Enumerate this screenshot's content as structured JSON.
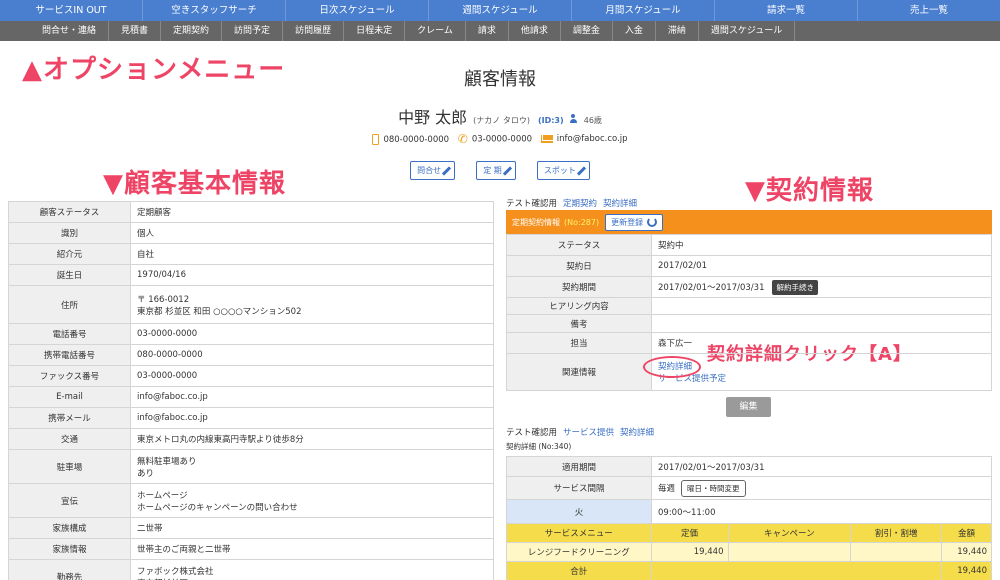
{
  "nav_primary": [
    "サービスIN OUT",
    "空きスタッフサーチ",
    "日次スケジュール",
    "週間スケジュール",
    "月間スケジュール",
    "請求一覧",
    "売上一覧"
  ],
  "nav_secondary": [
    "問合せ・連絡",
    "見積書",
    "定期契約",
    "訪問予定",
    "訪問履歴",
    "日程未定",
    "クレーム",
    "請求",
    "他請求",
    "調整金",
    "入金",
    "滞納",
    "週間スケジュール"
  ],
  "annotations": {
    "option_menu": "▲オプションメニュー",
    "basic_info": "▼顧客基本情報",
    "contract_info": "▼契約情報",
    "click_note": "契約詳細クリック【A】"
  },
  "page_title": "顧客情報",
  "customer": {
    "name": "中野 太郎",
    "kana": "(ナカノ タロウ)",
    "id": "(ID:3)",
    "age": "46歳",
    "mobile": "080-0000-0000",
    "phone": "03-0000-0000",
    "email": "info@faboc.co.jp"
  },
  "action_buttons": [
    "問合せ",
    "定 期",
    "スポット"
  ],
  "basic_table": [
    {
      "k": "顧客ステータス",
      "v": [
        "定期顧客"
      ],
      "h": 21
    },
    {
      "k": "識別",
      "v": [
        "個人"
      ],
      "h": 21
    },
    {
      "k": "紹介元",
      "v": [
        "自社"
      ],
      "h": 21
    },
    {
      "k": "誕生日",
      "v": [
        "1970/04/16"
      ],
      "h": 21
    },
    {
      "k": "住所",
      "v": [
        "〒 166-0012",
        "東京都 杉並区 和田 ○○○○マンション502"
      ],
      "h": 38
    },
    {
      "k": "電話番号",
      "v": [
        "03-0000-0000"
      ],
      "h": 21
    },
    {
      "k": "携帯電話番号",
      "v": [
        "080-0000-0000"
      ],
      "h": 21
    },
    {
      "k": "ファックス番号",
      "v": [
        "03-0000-0000"
      ],
      "h": 21
    },
    {
      "k": "E-mail",
      "v": [
        "info@faboc.co.jp"
      ],
      "h": 21
    },
    {
      "k": "携帯メール",
      "v": [
        "info@faboc.co.jp"
      ],
      "h": 21
    },
    {
      "k": "交通",
      "v": [
        "東京メトロ丸の内線東高円寺駅より徒歩8分"
      ],
      "h": 21
    },
    {
      "k": "駐車場",
      "v": [
        "無料駐車場あり",
        "あり"
      ],
      "h": 34
    },
    {
      "k": "宣伝",
      "v": [
        "ホームページ",
        "ホームページのキャンペーンの問い合わせ"
      ],
      "h": 34
    },
    {
      "k": "家族構成",
      "v": [
        "二世帯"
      ],
      "h": 21
    },
    {
      "k": "家族情報",
      "v": [
        "世帯主のご両親と二世帯"
      ],
      "h": 21
    },
    {
      "k": "勤務先",
      "v": [
        "ファボック株式会社",
        "東京都杉並区"
      ],
      "h": 34
    }
  ],
  "contract": {
    "header_prefix": "テスト確認用",
    "header_links": [
      "定期契約",
      "契約詳細"
    ],
    "bar_label": "定期契約情報",
    "bar_no": "(No:287)",
    "update_label": "更新登録",
    "status_k": "ステータス",
    "status_v": "契約中",
    "date_k": "契約日",
    "date_v": "2017/02/01",
    "period_k": "契約期間",
    "period_v": "2017/02/01～2017/03/31",
    "cancel_btn": "解約手続き",
    "hearing_k": "ヒアリング内容",
    "hearing_v": "",
    "memo_k": "備考",
    "memo_v": "",
    "staff_k": "担当",
    "staff_v": "森下広一",
    "related_k": "関連情報",
    "related_links": [
      "契約詳細",
      "サービス提供予定"
    ],
    "edit_label": "編集"
  },
  "service": {
    "header_prefix": "テスト確認用",
    "header_links": [
      "サービス提供",
      "契約詳細"
    ],
    "detail_no": "契約詳細 (No:340)",
    "period_k": "適用期間",
    "period_v": "2017/02/01～2017/03/31",
    "interval_k": "サービス間隔",
    "interval_v": "毎週",
    "interval_btn": "曜日・時間変更",
    "weekday": "火",
    "time": "09:00～11:00",
    "menu_headers": [
      "サービスメニュー",
      "定価",
      "キャンペーン",
      "割引・割増",
      "金額"
    ],
    "menu_rows": [
      {
        "name": "レンジフードクリーニング",
        "price": "19,440",
        "campaign": "",
        "discount": "",
        "amount": "19,440"
      }
    ],
    "total_label": "合計",
    "total_amount": "19,440"
  }
}
